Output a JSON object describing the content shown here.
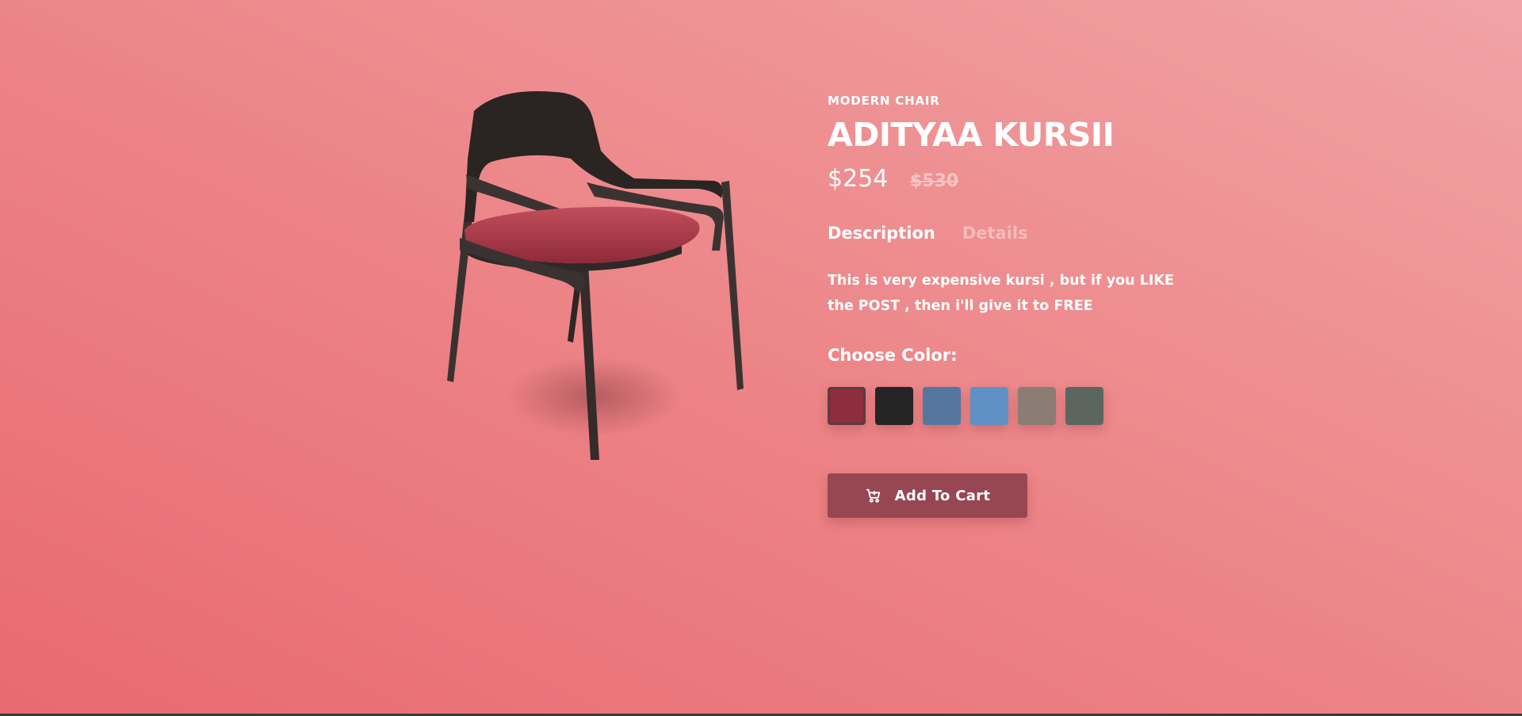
{
  "product": {
    "category": "MODERN CHAIR",
    "name": "ADITYAA KURSII",
    "price": "$254",
    "old_price": "$530",
    "image_alt_icon": "chair-image"
  },
  "tabs": [
    {
      "label": "Description",
      "active": true
    },
    {
      "label": "Details",
      "active": false
    }
  ],
  "description": "This is very expensive kursi , but if you LIKE the POST , then i'll give it to FREE",
  "colors": {
    "label": "Choose Color:",
    "swatches": [
      {
        "color": "#8d2d3e",
        "selected": true
      },
      {
        "color": "#242424",
        "selected": false
      },
      {
        "color": "#55779f",
        "selected": false
      },
      {
        "color": "#5f91c4",
        "selected": false
      },
      {
        "color": "#8b7d73",
        "selected": false
      },
      {
        "color": "#5d6561",
        "selected": false
      }
    ]
  },
  "cart_button": {
    "label": "Add To Cart",
    "icon": "cart-icon"
  }
}
